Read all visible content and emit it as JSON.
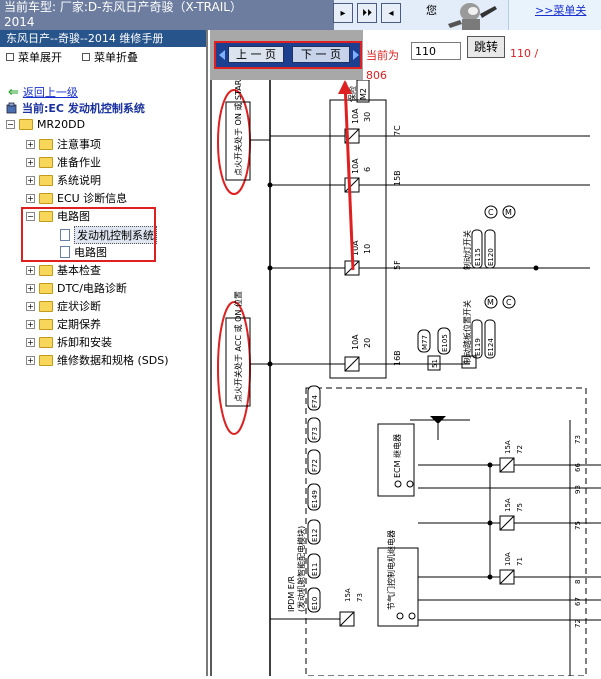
{
  "header": {
    "title_line1": "当前车型:  厂家:D-东风日产奇骏（X-TRAIL）",
    "title_line2": "2014",
    "top_char": "您",
    "menu_link": ">>菜单关",
    "nav_buttons": [
      "▸",
      "⏵⏵",
      "◂"
    ]
  },
  "sidebar": {
    "manual_title": "东风日产--奇骏--2014 维修手册",
    "expand_label": "菜单展开",
    "collapse_label": "菜单折叠",
    "back_link": "返回上一级",
    "current_label": "当前:EC 发动机控制系统",
    "root": "MR20DD",
    "items": [
      {
        "label": "注意事项"
      },
      {
        "label": "准备作业"
      },
      {
        "label": "系统说明"
      },
      {
        "label": "ECU 诊断信息"
      },
      {
        "label": "电路图"
      },
      {
        "label": "发动机控制系统"
      },
      {
        "label": "电路图"
      },
      {
        "label": "基本检查"
      },
      {
        "label": "DTC/电路诊断"
      },
      {
        "label": "症状诊断"
      },
      {
        "label": "定期保养"
      },
      {
        "label": "拆卸和安装"
      },
      {
        "label": "维修数据和规格 (SDS)"
      }
    ]
  },
  "pager": {
    "prev_label": "上 一 页",
    "next_label": "下 一 页",
    "current_prefix": "当前为",
    "page_value": "110",
    "jump_label": "跳转",
    "total_line1": "110 /",
    "total_line2": "806"
  },
  "diagram": {
    "labels": {
      "ign_on_start": "点火开关处于 ON 或 START 位置",
      "ign_acc_on": "点火开关处于 ACC 或 ON 位置",
      "relay_box": "保险",
      "m2": "M2",
      "fuse1_a": "10A",
      "fuse1_n": "30",
      "fuse1_pin": "7C",
      "fuse2_a": "10A",
      "fuse2_n": "6",
      "fuse2_pin": "15B",
      "fuse3_a": "10A",
      "fuse3_n": "10",
      "fuse3_pin": "5F",
      "fuse4_a": "10A",
      "fuse4_n": "20",
      "fuse4_pin": "16B",
      "brake_lamp_sw": "制动灯开关",
      "e115": "E115",
      "e120": "E120",
      "brake_pos_sw": "制动踏板位置开关",
      "e119": "E119",
      "e124": "E124",
      "c1": "C",
      "m1": "M",
      "m3": "M",
      "c2": "C",
      "m77": "M77",
      "e105": "E105",
      "n51": "51",
      "f74": "F74",
      "f73": "F73",
      "f72": "F72",
      "e149": "E149",
      "e12": "E12",
      "e11": "E11",
      "e10": "E10",
      "ipdm": "IPDM E/R",
      "ipdm_sub": "(发动机舱智能配电模块)",
      "ecm_relay": "ECM 继电器",
      "throttle_relay": "节气门控制电机继电器",
      "f15a_1": "15A",
      "f72n": "72",
      "f15a_2": "15A",
      "f75n": "75",
      "f10a": "10A",
      "f71n": "71",
      "f15a_3": "15A",
      "f73n": "73",
      "w73": "73",
      "w66": "66",
      "w93": "93",
      "w75": "75",
      "w8": "8",
      "w67": "67",
      "w72": "72"
    }
  }
}
